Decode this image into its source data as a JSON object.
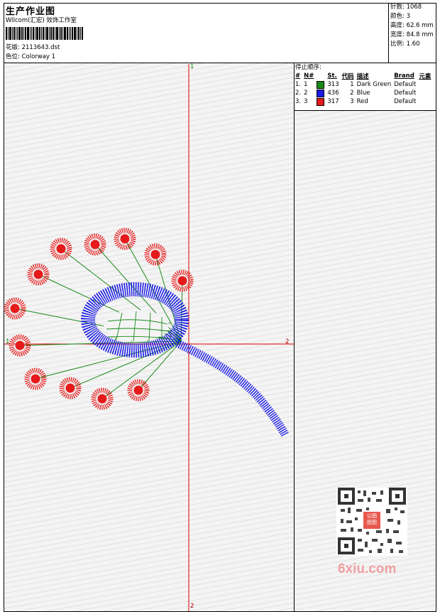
{
  "header": {
    "title": "生产作业图",
    "company": "Wilcom(汇宏) 效饰工作室",
    "design_label": "花版:",
    "design_value": "2113643.dst",
    "colorway_label": "色位:",
    "colorway_value": "Colorway 1"
  },
  "stats": [
    {
      "label": "针数:",
      "value": "1068"
    },
    {
      "label": "颜色:",
      "value": "3"
    },
    {
      "label": "高度:",
      "value": "62.6 mm"
    },
    {
      "label": "宽度:",
      "value": "84.8 mm"
    },
    {
      "label": "比例:",
      "value": "1.60"
    }
  ],
  "sequence": {
    "title": "停止顺序:",
    "headers": [
      "#",
      "N#",
      "St.",
      "代码",
      "描述",
      "Brand",
      "元素"
    ],
    "rows": [
      {
        "index": "1.",
        "needle": "1",
        "color": "#1a8a1a",
        "stitches": "313",
        "code": "1",
        "description": "Dark Green",
        "brand": "Default"
      },
      {
        "index": "2.",
        "needle": "2",
        "color": "#1a1ae6",
        "stitches": "436",
        "code": "2",
        "description": "Blue",
        "brand": "Default"
      },
      {
        "index": "3.",
        "needle": "3",
        "color": "#e61a1a",
        "stitches": "317",
        "code": "3",
        "description": "Red",
        "brand": "Default"
      }
    ]
  },
  "axis_labels": {
    "top": "1",
    "left": "1",
    "right": "2",
    "bottom": "2"
  },
  "watermark": {
    "text": "6xiu.com",
    "seal": "以图\n图图"
  },
  "colors": {
    "green": "#1a8a1a",
    "blue": "#1a1ae6",
    "red": "#e61a1a",
    "axis": "#e00000"
  }
}
